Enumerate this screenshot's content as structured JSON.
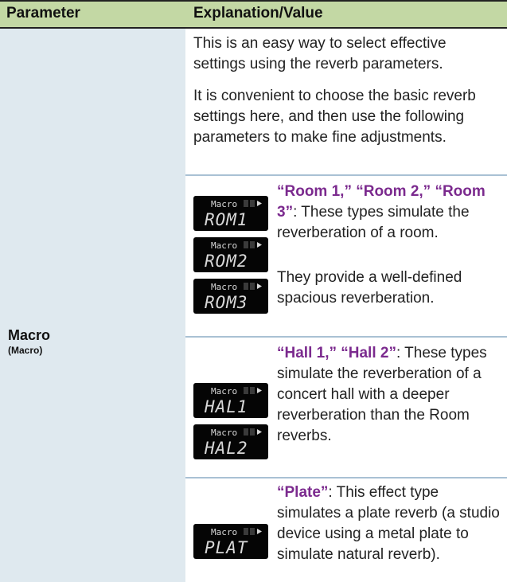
{
  "header": {
    "col1": "Parameter",
    "col2": "Explanation/Value"
  },
  "parameter": {
    "name": "Macro",
    "sub": "(Macro)"
  },
  "intro": {
    "p1": "This is an easy way to select effective settings using the reverb parameters.",
    "p2": "It is convenient to choose the basic reverb settings here, and then use the following parameters to make fine adjustments."
  },
  "rows": [
    {
      "displays": [
        {
          "label": "Macro",
          "value": "ROM1"
        },
        {
          "label": "Macro",
          "value": "ROM2"
        },
        {
          "label": "Macro",
          "value": "ROM3"
        }
      ],
      "title": "“Room 1,” “Room 2,” “Room 3”",
      "desc": ": These types simulate the reverberation of a room.",
      "extra": "They provide a well-defined spacious reverberation."
    },
    {
      "displays": [
        {
          "label": "Macro",
          "value": "HAL1"
        },
        {
          "label": "Macro",
          "value": "HAL2"
        }
      ],
      "title": "“Hall 1,” “Hall 2”",
      "desc": ": These types simulate the reverberation of a concert hall with a deeper reverberation than the Room reverbs."
    },
    {
      "displays": [
        {
          "label": "Macro",
          "value": "PLAT"
        }
      ],
      "title": "“Plate”",
      "desc": ": This effect type simulates a plate reverb (a studio device using a metal plate to simulate natural reverb)."
    }
  ],
  "colors": {
    "header_bg": "#c3d8a4",
    "left_bg": "#dfe9ef",
    "highlight": "#7b2a8e",
    "lcd_bg": "#050505",
    "lcd_text": "#d8d8d8"
  }
}
